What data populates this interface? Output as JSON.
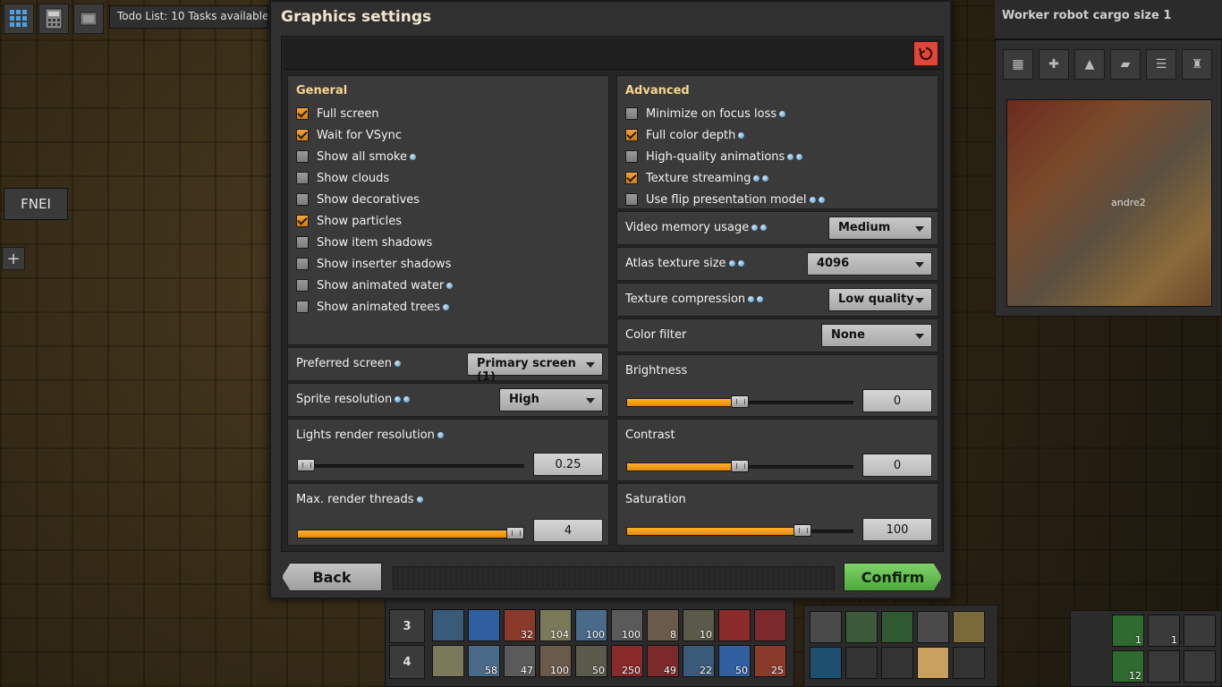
{
  "hud": {
    "todo_text": "Todo List: 10 Tasks available",
    "fnei_label": "FNEI",
    "research_title": "Worker robot cargo size 1",
    "minimap_player": "andre2",
    "quickbar_row_labels": [
      "3",
      "4"
    ],
    "quickbar_row3_counts": [
      "",
      "",
      "32",
      "104",
      "100",
      "100",
      "8",
      "10",
      "",
      ""
    ],
    "quickbar_row4_counts": [
      "",
      "58",
      "47",
      "100",
      "50",
      "250",
      "49",
      "22",
      "50",
      "25"
    ],
    "right_slot_counts": [
      "1",
      "1",
      "12"
    ]
  },
  "dialog": {
    "title": "Graphics settings",
    "general": {
      "heading": "General",
      "options": [
        {
          "label": "Full screen",
          "checked": true,
          "info": 0
        },
        {
          "label": "Wait for VSync",
          "checked": true,
          "info": 0
        },
        {
          "label": "Show all smoke",
          "checked": false,
          "info": 1
        },
        {
          "label": "Show clouds",
          "checked": false,
          "info": 0
        },
        {
          "label": "Show decoratives",
          "checked": false,
          "info": 0
        },
        {
          "label": "Show particles",
          "checked": true,
          "info": 0
        },
        {
          "label": "Show item shadows",
          "checked": false,
          "info": 0
        },
        {
          "label": "Show inserter shadows",
          "checked": false,
          "info": 0
        },
        {
          "label": "Show animated water",
          "checked": false,
          "info": 1
        },
        {
          "label": "Show animated trees",
          "checked": false,
          "info": 1
        }
      ],
      "preferred_screen": {
        "label": "Preferred screen",
        "value": "Primary screen (1)"
      },
      "sprite_resolution": {
        "label": "Sprite resolution",
        "value": "High"
      },
      "lights_render_resolution": {
        "label": "Lights render resolution",
        "value": "0.25",
        "fraction": 0.0
      },
      "max_render_threads": {
        "label": "Max. render threads",
        "value": "4",
        "fraction": 1.0
      }
    },
    "advanced": {
      "heading": "Advanced",
      "options": [
        {
          "label": "Minimize on focus loss",
          "checked": false,
          "info": 1
        },
        {
          "label": "Full color depth",
          "checked": true,
          "info": 1
        },
        {
          "label": "High-quality animations",
          "checked": false,
          "info": 2
        },
        {
          "label": "Texture streaming",
          "checked": true,
          "info": 2
        },
        {
          "label": "Use flip presentation model",
          "checked": false,
          "info": 2
        }
      ],
      "video_memory_usage": {
        "label": "Video memory usage",
        "value": "Medium"
      },
      "atlas_texture_size": {
        "label": "Atlas texture size",
        "value": "4096"
      },
      "texture_compression": {
        "label": "Texture compression",
        "value": "Low quality"
      },
      "color_filter": {
        "label": "Color filter",
        "value": "None"
      },
      "brightness": {
        "label": "Brightness",
        "value": "0",
        "fraction": 0.5
      },
      "contrast": {
        "label": "Contrast",
        "value": "0",
        "fraction": 0.5
      },
      "saturation": {
        "label": "Saturation",
        "value": "100",
        "fraction": 0.8
      }
    },
    "buttons": {
      "back": "Back",
      "confirm": "Confirm"
    }
  },
  "colors": {
    "accent_orange": "#f0a020",
    "confirm_green": "#5fbf4a",
    "reset_red": "#e0463a",
    "heading_gold": "#f6d68f"
  }
}
